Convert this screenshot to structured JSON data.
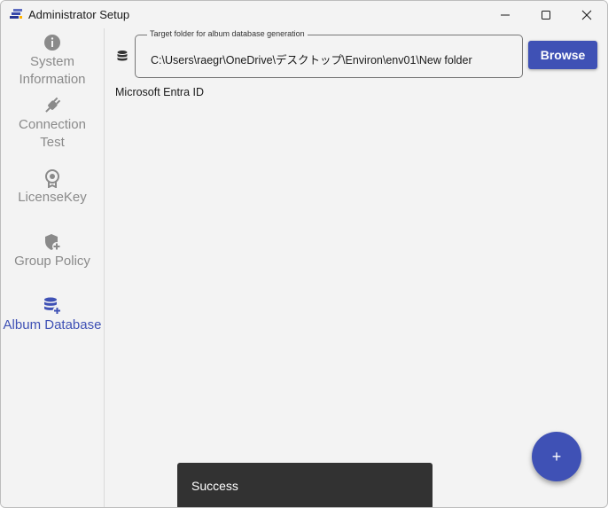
{
  "window": {
    "title": "Administrator Setup",
    "controls": [
      "minimize-icon",
      "maximize-icon",
      "close-icon"
    ]
  },
  "sidebar": {
    "items": [
      {
        "label": "System\nInformation",
        "icon": "info-icon",
        "active": false
      },
      {
        "label": "Connection\nTest",
        "icon": "plug-icon",
        "active": false
      },
      {
        "label": "LicenseKey",
        "icon": "award-badge-icon",
        "active": false
      },
      {
        "label": "Group Policy",
        "icon": "shield-plus-icon",
        "active": false
      },
      {
        "label": "Album Database",
        "icon": "database-plus-icon",
        "active": true
      }
    ]
  },
  "main": {
    "folder_field": {
      "legend": "Target folder for album database generation",
      "value": "C:\\Users\\raegr\\OneDrive\\デスクトップ\\Environ\\env01\\New folder",
      "icon": "database-icon"
    },
    "browse_label": "Browse",
    "entra_label": "Microsoft Entra ID"
  },
  "toast": {
    "text": "Success"
  },
  "fab": {
    "label": "+",
    "icon": "plus-icon"
  },
  "colors": {
    "accent": "#3f51b5",
    "inactive": "#8a8a8a",
    "toast_bg": "#323232"
  }
}
